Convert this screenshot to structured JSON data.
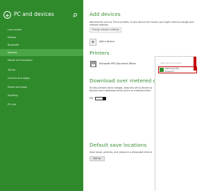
{
  "sidebar": {
    "title": "PC and devices",
    "items": [
      {
        "label": "Lock screen"
      },
      {
        "label": "Display"
      },
      {
        "label": "Bluetooth"
      },
      {
        "label": "Devices",
        "active": true
      },
      {
        "label": "Mouse and touchpad"
      },
      {
        "label": "Typing"
      },
      {
        "label": "Corners and edges"
      },
      {
        "label": "Power and sleep"
      },
      {
        "label": "AutoPlay"
      },
      {
        "label": "PC info"
      }
    ]
  },
  "main": {
    "add_devices": {
      "title": "Add devices",
      "desc_line1": "Add devices such as TVs or printers. If your device isn't found, you might need to change your",
      "desc_line2": "network settings.",
      "link": "Change network settings",
      "add_label": "Add a device"
    },
    "printers": {
      "title": "Printers",
      "item_label": "Microsoft XPS Document Writer"
    },
    "metered": {
      "title": "Download over metered conne",
      "desc_line1": "To help prevent extra charges, keep this off so device so",
      "desc_line2": "devices won't download while you're on metered Intern",
      "toggle_text": "Off"
    },
    "default_save": {
      "title": "Default save locations",
      "desc": "Save music, pictures, and videos to a removable drive b",
      "button": "Set up"
    }
  },
  "flyout": {
    "header": "· · · · · ·",
    "title": "Searching for devices",
    "item_name": "Samsung_FHA",
    "item_sub": "Television"
  },
  "colors": {
    "sidebar_bg": "#2f8a2c",
    "sidebar_active": "#4aa646",
    "heading_green": "#3c8e37",
    "highlight_red": "#c00000"
  },
  "icons": {
    "back": "back-arrow-icon",
    "search": "search-icon",
    "add": "plus-icon",
    "printer": "printer-icon",
    "tv": "tv-icon"
  }
}
